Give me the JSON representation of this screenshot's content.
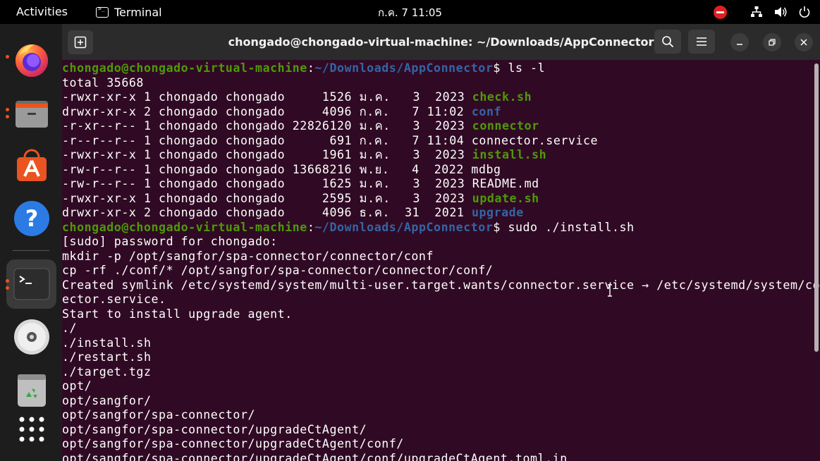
{
  "topbar": {
    "activities": "Activities",
    "app_name": "Terminal",
    "clock": "ก.ค. 7  11:05",
    "icons": [
      "do-not-disturb-icon",
      "network-icon",
      "volume-icon",
      "power-icon"
    ]
  },
  "dock": {
    "items": [
      {
        "name": "firefox",
        "icon": "firefox-icon",
        "running": true
      },
      {
        "name": "files",
        "icon": "files-icon",
        "running": true
      },
      {
        "name": "app-center",
        "icon": "app-center-icon",
        "running": false
      },
      {
        "name": "help",
        "icon": "help-icon",
        "running": false
      },
      {
        "name": "terminal",
        "icon": "terminal-icon",
        "running": true,
        "active": true
      },
      {
        "name": "disc",
        "icon": "disc-icon",
        "running": false
      },
      {
        "name": "trash",
        "icon": "trash-icon",
        "running": false
      },
      {
        "name": "show-apps",
        "icon": "grid-icon",
        "running": false
      }
    ]
  },
  "window": {
    "title": "chongado@chongado-virtual-machine: ~/Downloads/AppConnector"
  },
  "terminal": {
    "prompt_user": "chongado@chongado-virtual-machine",
    "prompt_path": "~/Downloads/AppConnector",
    "cmd1": "$ ls -l",
    "cmd2": "$ sudo ./install.sh",
    "total": "total 35668",
    "ls_rows": [
      {
        "meta": "-rwxr-xr-x 1 chongado chongado     1526 ม.ค.   3  2023 ",
        "name": "check.sh",
        "kind": "exe"
      },
      {
        "meta": "drwxr-xr-x 2 chongado chongado     4096 ก.ค.   7 11:02 ",
        "name": "conf",
        "kind": "dir"
      },
      {
        "meta": "-r-xr--r-- 1 chongado chongado 22826120 ม.ค.   3  2023 ",
        "name": "connector",
        "kind": "exe"
      },
      {
        "meta": "-r--r--r-- 1 chongado chongado      691 ก.ค.   7 11:04 ",
        "name": "connector.service",
        "kind": "file"
      },
      {
        "meta": "-rwxr-xr-x 1 chongado chongado     1961 ม.ค.   3  2023 ",
        "name": "install.sh",
        "kind": "exe"
      },
      {
        "meta": "-rw-r--r-- 1 chongado chongado 13668216 พ.ย.   4  2022 ",
        "name": "mdbg",
        "kind": "file"
      },
      {
        "meta": "-rw-r--r-- 1 chongado chongado     1625 ม.ค.   3  2023 ",
        "name": "README.md",
        "kind": "file"
      },
      {
        "meta": "-rwxr-xr-x 1 chongado chongado     2595 ม.ค.   3  2023 ",
        "name": "update.sh",
        "kind": "exe"
      },
      {
        "meta": "drwxr-xr-x 2 chongado chongado     4096 ธ.ค.  31  2021 ",
        "name": "upgrade",
        "kind": "dir"
      }
    ],
    "output": [
      "[sudo] password for chongado:",
      "mkdir -p /opt/sangfor/spa-connector/connector/conf",
      "cp -rf ./conf/* /opt/sangfor/spa-connector/connector/conf/",
      "Created symlink /etc/systemd/system/multi-user.target.wants/connector.service → /etc/systemd/system/conn",
      "ector.service.",
      "Start to install upgrade agent.",
      "./",
      "./install.sh",
      "./restart.sh",
      "./target.tgz",
      "opt/",
      "opt/sangfor/",
      "opt/sangfor/spa-connector/",
      "opt/sangfor/spa-connector/upgradeCtAgent/",
      "opt/sangfor/spa-connector/upgradeCtAgent/conf/",
      "opt/sangfor/spa-connector/upgradeCtAgent/conf/upgradeCtAgent.toml.in"
    ]
  },
  "colors": {
    "terminal_bg": "#300a24",
    "prompt_user": "#4e9a06",
    "prompt_path": "#3465a4",
    "accent": "#e95420"
  }
}
